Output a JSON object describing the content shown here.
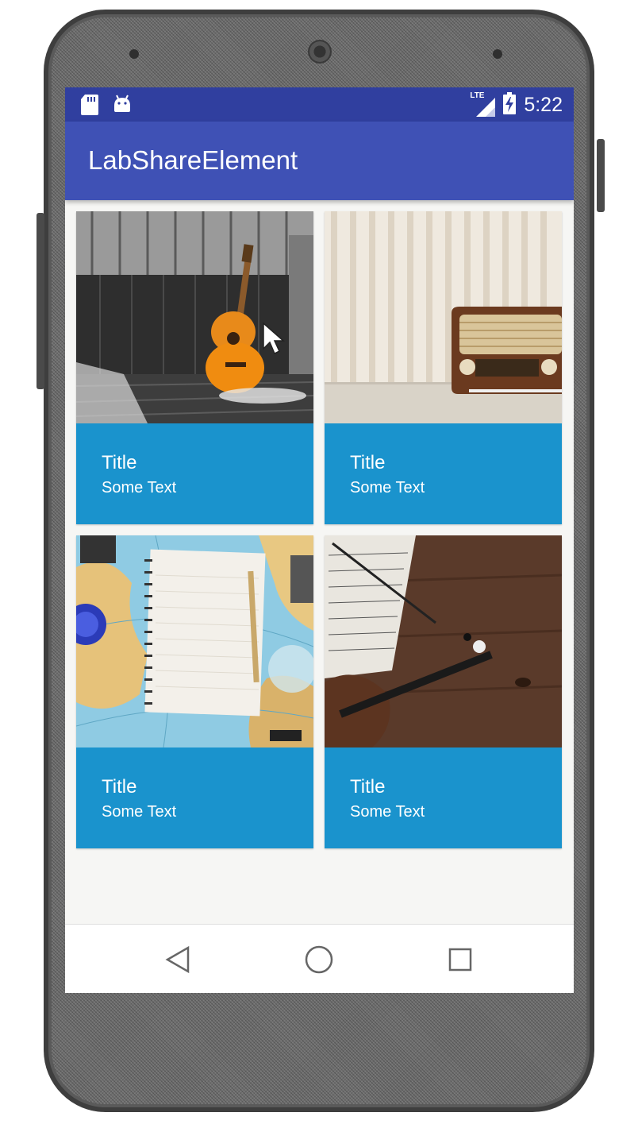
{
  "status_bar": {
    "time": "5:22",
    "network": "LTE",
    "icons": [
      "sd-card-icon",
      "android-icon",
      "lte-signal-icon",
      "battery-charging-icon"
    ]
  },
  "app_bar": {
    "title": "LabShareElement"
  },
  "cards": [
    {
      "title": "Title",
      "text": "Some Text",
      "image": "guitar-photo"
    },
    {
      "title": "Title",
      "text": "Some Text",
      "image": "radio-photo"
    },
    {
      "title": "Title",
      "text": "Some Text",
      "image": "notebook-map-photo"
    },
    {
      "title": "Title",
      "text": "Some Text",
      "image": "violin-sheet-music-photo"
    }
  ],
  "nav_bar": {
    "icons": [
      "back-icon",
      "home-icon",
      "recents-icon"
    ]
  },
  "colors": {
    "status_bar": "#303f9f",
    "app_bar": "#3f51b5",
    "card": "#1a93cd",
    "background": "#f6f6f4"
  }
}
